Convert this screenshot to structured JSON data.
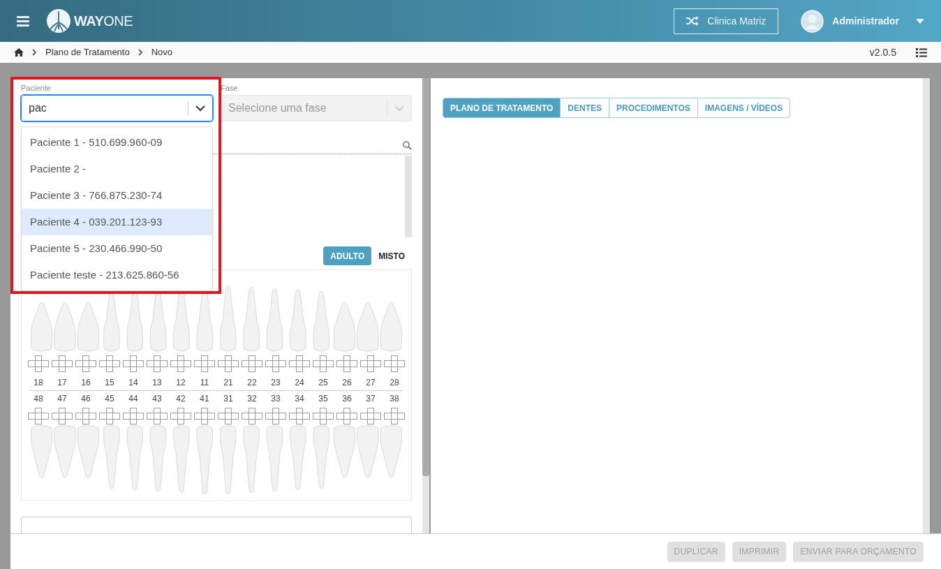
{
  "header": {
    "logo": {
      "bold": "WAY",
      "light": "ONE"
    },
    "clinic_button": "Clinica Matriz",
    "user": "Administrador"
  },
  "breadcrumb": [
    "Plano de Tratamento",
    "Novo"
  ],
  "version": "v2.0.5",
  "patient_field": {
    "label": "Paciente",
    "value": "pac",
    "focused": true
  },
  "phase_field": {
    "label": "Fase",
    "placeholder": "Selecione uma fase",
    "disabled": true
  },
  "patient_options": [
    {
      "label": "Paciente 1 - 510.699.960-09",
      "selected": false
    },
    {
      "label": "Paciente 2 -",
      "selected": false
    },
    {
      "label": "Paciente 3 - 766.875.230-74",
      "selected": false
    },
    {
      "label": "Paciente 4 - 039.201.123-93",
      "selected": true
    },
    {
      "label": "Paciente 5 - 230.466.990-50",
      "selected": false
    },
    {
      "label": "Paciente teste - 213.625.860-56",
      "selected": false
    }
  ],
  "dentition": [
    {
      "label": "ADULTO",
      "selected": true
    },
    {
      "label": "MISTO",
      "selected": false
    }
  ],
  "teeth": {
    "upper": [
      "18",
      "17",
      "16",
      "15",
      "14",
      "13",
      "12",
      "11",
      "21",
      "22",
      "23",
      "24",
      "25",
      "26",
      "27",
      "28"
    ],
    "lower": [
      "48",
      "47",
      "46",
      "45",
      "44",
      "43",
      "42",
      "41",
      "31",
      "32",
      "33",
      "34",
      "35",
      "36",
      "37",
      "38"
    ]
  },
  "tabs": [
    {
      "label": "PLANO DE TRATAMENTO",
      "selected": true
    },
    {
      "label": "DENTES",
      "selected": false
    },
    {
      "label": "PROCEDIMENTOS",
      "selected": false
    },
    {
      "label": "IMAGENS / VÍDEOS",
      "selected": false
    }
  ],
  "footer_buttons": [
    {
      "label": "DUPLICAR",
      "disabled": true
    },
    {
      "label": "IMPRIMIR",
      "disabled": true
    },
    {
      "label": "ENVIAR PARA ORÇAMENTO",
      "disabled": true
    }
  ]
}
